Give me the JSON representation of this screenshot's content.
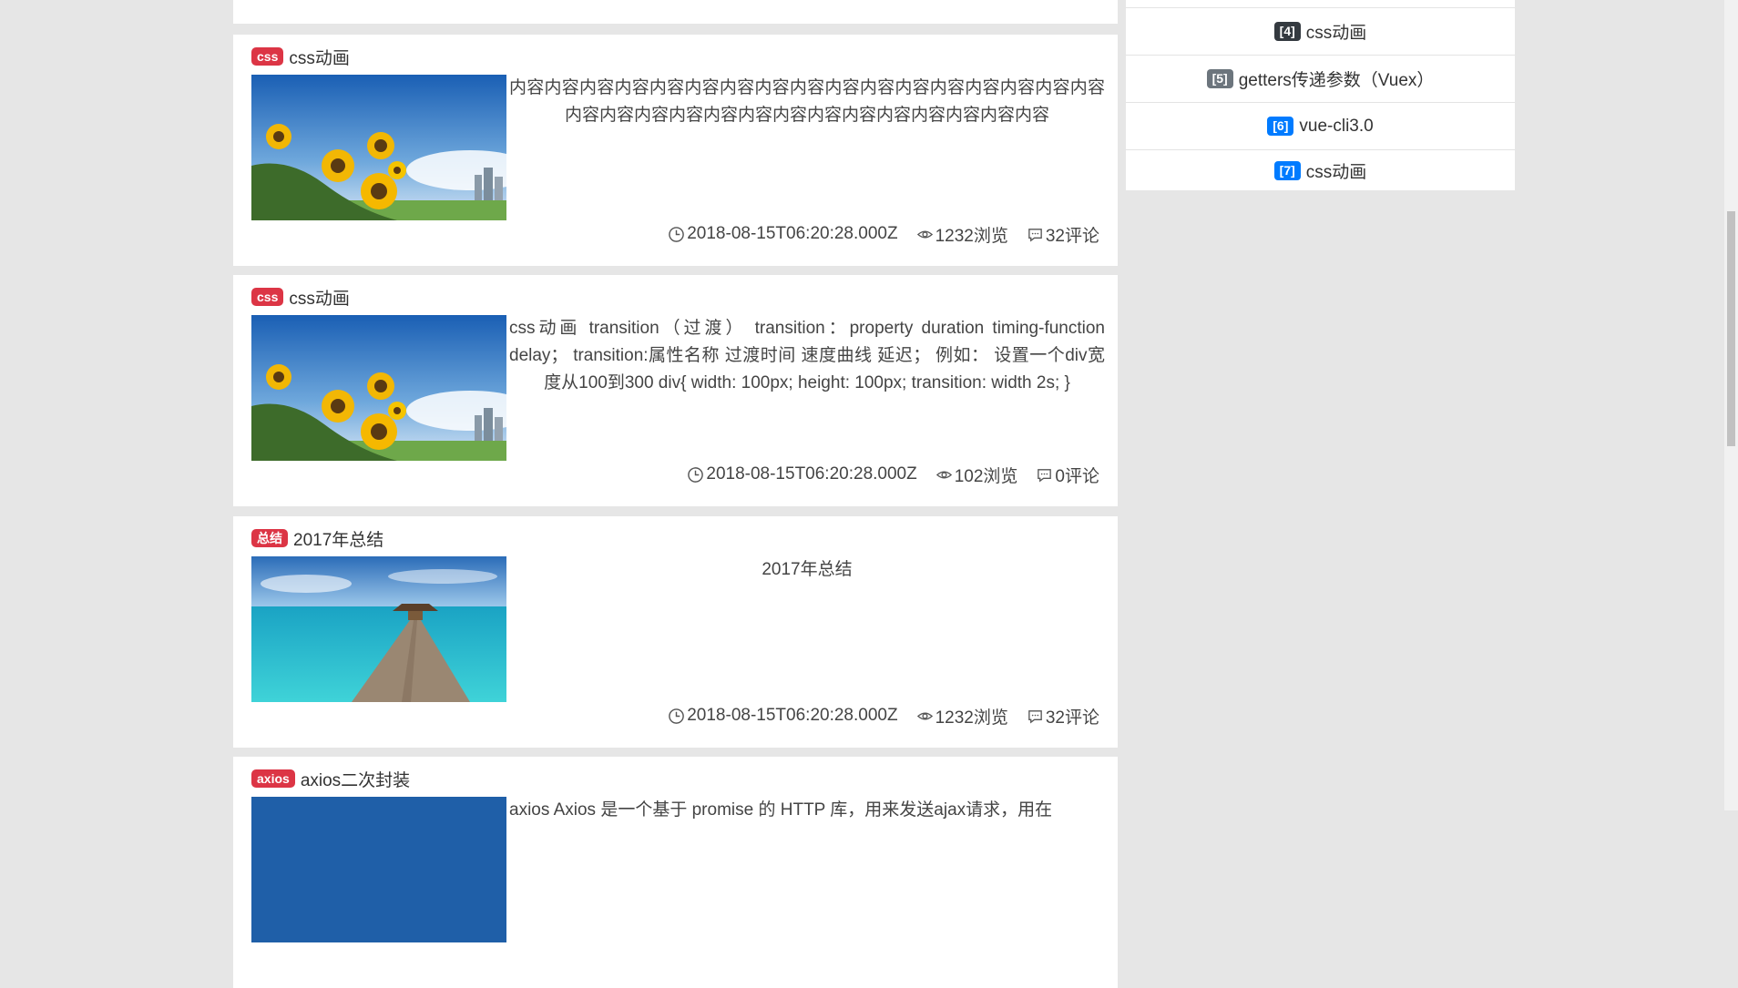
{
  "articles": [
    {
      "tag": "",
      "title": "",
      "content": "",
      "date": "",
      "views": "",
      "comments": ""
    },
    {
      "tag": "css",
      "title": "css动画",
      "image": "sunflowers",
      "content": "内容内容内容内容内容内容内容内容内容内容内容内容内容内容内容内容内容内容内容内容内容内容内容内容内容内容内容内容内容内容内容",
      "date": "2018-08-15T06:20:28.000Z",
      "views": "1232浏览",
      "comments": "32评论"
    },
    {
      "tag": "css",
      "title": "css动画",
      "image": "sunflowers",
      "content": "css动画  transition（过渡）  transition：property duration timing-function delay；  transition:属性名称 过渡时间 速度曲线 延迟；  例如：  设置一个div宽度从100到300   div{ width: 100px; height: 100px; transition: width 2s; }",
      "date": "2018-08-15T06:20:28.000Z",
      "views": "102浏览",
      "comments": "0评论"
    },
    {
      "tag": "总结",
      "title": "2017年总结",
      "image": "pier",
      "content": "2017年总结",
      "date": "2018-08-15T06:20:28.000Z",
      "views": "1232浏览",
      "comments": "32评论"
    },
    {
      "tag": "axios",
      "title": "axios二次封装",
      "image": "sky",
      "content": "axios  Axios 是一个基于 promise 的 HTTP 库，用来发送ajax请求，用在"
    }
  ],
  "sidebar": {
    "items": [
      {
        "rank": "[4]",
        "title": "css动画",
        "color": "#343a40"
      },
      {
        "rank": "[5]",
        "title": "getters传递参数（Vuex）",
        "color": "#6c757d"
      },
      {
        "rank": "[6]",
        "title": "vue-cli3.0",
        "color": "#007bff"
      },
      {
        "rank": "[7]",
        "title": "css动画",
        "color": "#007bff"
      }
    ]
  },
  "colors": {
    "badge": "#dc3545",
    "background": "#e6e6e6"
  },
  "icons": {
    "date": "clock-icon",
    "views": "eye-icon",
    "comments": "comment-icon"
  }
}
